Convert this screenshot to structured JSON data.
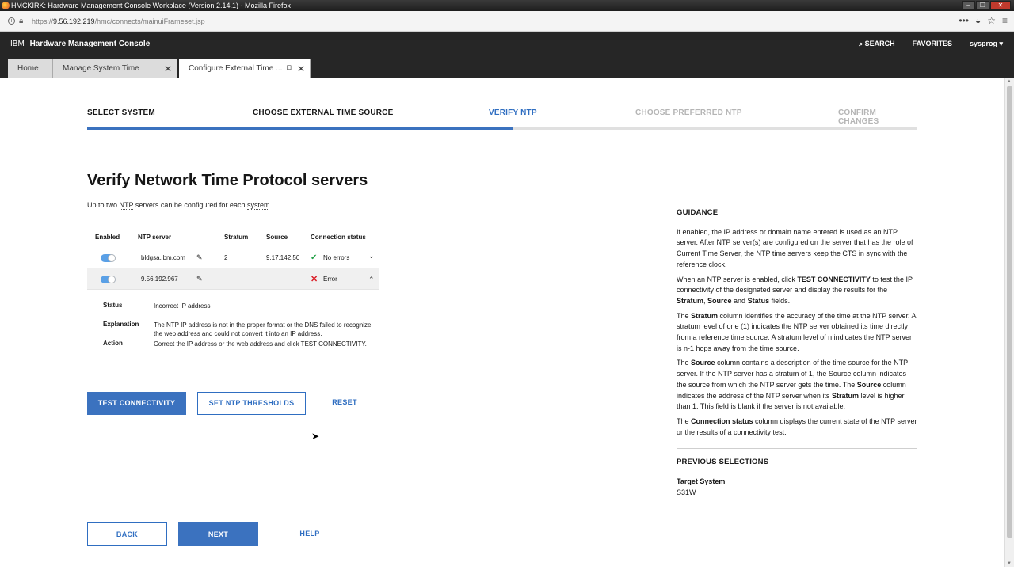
{
  "window": {
    "title": "HMCKIRK: Hardware Management Console Workplace (Version 2.14.1) - Mozilla Firefox",
    "buttons": [
      "–",
      "❐",
      "✕"
    ]
  },
  "browser": {
    "url_prefix": "https://",
    "url_host": "9.56.192.219",
    "url_path": "/hmc/connects/mainuiFrameset.jsp",
    "tool_icons": [
      "•••",
      "◒",
      "☆",
      "≡"
    ]
  },
  "header": {
    "ibm": "IBM",
    "product": "Hardware Management Console",
    "search": "SEARCH",
    "favorites": "FAVORITES",
    "user": "sysprog ▾"
  },
  "tabs": [
    {
      "label": "Home"
    },
    {
      "label": "Manage System Time",
      "close": "✕"
    },
    {
      "label": "Configure External Time ...",
      "close": "✕",
      "popout": "⧉"
    }
  ],
  "steps": [
    {
      "label": "SELECT SYSTEM",
      "state": "done"
    },
    {
      "label": "CHOOSE EXTERNAL TIME SOURCE",
      "state": "done"
    },
    {
      "label": "VERIFY NTP",
      "state": "current"
    },
    {
      "label": "CHOOSE PREFERRED NTP",
      "state": "future"
    },
    {
      "label": "CONFIRM CHANGES",
      "state": "future"
    }
  ],
  "progress_fraction": 0.512,
  "page": {
    "title": "Verify Network Time Protocol servers",
    "subtitle_pre": "Up to two ",
    "subtitle_term1": "NTP",
    "subtitle_mid": " servers can be configured for each ",
    "subtitle_term2": "system",
    "subtitle_post": "."
  },
  "table": {
    "headers": {
      "enabled": "Enabled",
      "server": "NTP server",
      "stratum": "Stratum",
      "source": "Source",
      "status": "Connection status"
    },
    "rows": [
      {
        "enabled": true,
        "server": "bldgsa.ibm.com",
        "stratum": "2",
        "source": "9.17.142.50",
        "status": "No errors",
        "status_icon": "✔",
        "chevron": "⌄"
      },
      {
        "enabled": true,
        "server": "9.56.192.967",
        "stratum": "",
        "source": "",
        "status": "Error",
        "status_icon": "✕",
        "chevron": "⌃"
      }
    ],
    "details": {
      "status_label": "Status",
      "status_value": "Incorrect IP address",
      "explanation_label": "Explanation",
      "explanation_value": "The NTP IP address is not in the proper format or the DNS failed to recognize the web address and could not convert it into an IP address.",
      "action_label": "Action",
      "action_value": "Correct the IP address or the web address and click TEST CONNECTIVITY."
    },
    "edit_icon": "✎"
  },
  "buttons": {
    "test": "TEST CONNECTIVITY",
    "thresholds": "SET NTP THRESHOLDS",
    "reset": "RESET",
    "back": "BACK",
    "next": "NEXT",
    "help": "HELP"
  },
  "guidance": {
    "title": "GUIDANCE",
    "p1": "If enabled, the IP address or domain name entered is used as an NTP server. After NTP server(s) are configured on the server that has the role of Current Time Server, the NTP time servers keep the CTS in sync with the reference clock.",
    "p2a": "When an NTP server is enabled, click ",
    "p2b": "TEST CONNECTIVITY",
    "p2c": " to test the IP connectivity of the designated server and display the results for the ",
    "p2d": "Stratum",
    "p2e": ", ",
    "p2f": "Source",
    "p2g": " and ",
    "p2h": "Status",
    "p2i": " fields.",
    "p3a": "The ",
    "p3b": "Stratum",
    "p3c": " column identifies the accuracy of the time at the NTP server. A stratum level of one (1) indicates the NTP server obtained its time directly from a reference time source. A stratum level of n indicates the NTP server is n-1 hops away from the time source.",
    "p4a": "The ",
    "p4b": "Source",
    "p4c": " column contains a description of the time source for the NTP server. If the NTP server has a stratum of 1, the Source column indicates the source from which the NTP server gets the time. The ",
    "p4d": "Source",
    "p4e": " column indicates the address of the NTP server when its ",
    "p4f": "Stratum",
    "p4g": " level is higher than 1. This field is blank if the server is not available.",
    "p5a": "The ",
    "p5b": "Connection status",
    "p5c": " column displays the current state of the NTP server or the results of a connectivity test.",
    "prev_title": "PREVIOUS SELECTIONS",
    "target_label": "Target System",
    "target_value": "S31W"
  },
  "colors": {
    "accent": "#3b72bf",
    "header_bg": "#262626",
    "ok": "#24a148",
    "error": "#da1e28"
  }
}
